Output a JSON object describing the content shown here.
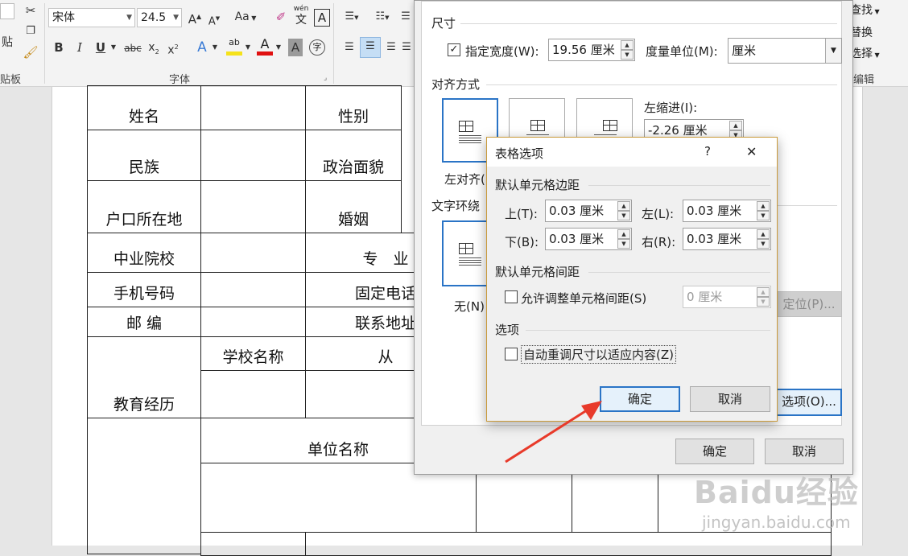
{
  "ribbon": {
    "clipboard": {
      "paste": "贴",
      "group": "贴板"
    },
    "font": {
      "font_name": "宋体",
      "font_size": "24.5",
      "group": "字体",
      "abc": "abc",
      "aa": "Aa",
      "wen": "wén",
      "wen_char": "文",
      "wen_box": "A",
      "char_a": "A",
      "circled": "字"
    },
    "editing": {
      "find": "查找",
      "replace": "替换",
      "select": "选择",
      "group": "编辑"
    },
    "colors": {
      "highlight": "#f5e21a",
      "font_color": "#e01010",
      "accent": "#2a74c6"
    }
  },
  "document": {
    "rows": [
      {
        "c1": "姓名",
        "c3": "性别"
      },
      {
        "c1": "民族",
        "c3": "政治面貌"
      },
      {
        "c1": "户口所在地",
        "c3": "婚姻"
      },
      {
        "c1": "中业院校",
        "c3": "专　业"
      },
      {
        "c1": "手机号码",
        "c3": "固定电话"
      },
      {
        "c1": "邮  编",
        "c3": "联系地址"
      }
    ],
    "edu": {
      "label": "教育经历",
      "school": "学校名称",
      "from": "从"
    },
    "work": {
      "unit": "单位名称"
    }
  },
  "table_properties": {
    "size_title": "尺寸",
    "width_check_label": "指定宽度(W):",
    "width_value": "19.56 厘米",
    "unit_label": "度量单位(M):",
    "unit_value": "厘米",
    "align_title": "对齐方式",
    "left_indent_label": "左缩进(I):",
    "left_indent_value": "-2.26 厘米",
    "align_left_label": "左对齐(L)",
    "wrap_title": "文字环绕",
    "wrap_none_label": "无(N)",
    "position_button": "定位(P)...",
    "options_button": "选项(O)...",
    "ok": "确定",
    "cancel": "取消"
  },
  "table_options": {
    "title": "表格选项",
    "help": "?",
    "close": "✕",
    "margins_title": "默认单元格边距",
    "top_label": "上(T):",
    "top_value": "0.03 厘米",
    "left_label": "左(L):",
    "left_value": "0.03 厘米",
    "bottom_label": "下(B):",
    "bottom_value": "0.03 厘米",
    "right_label": "右(R):",
    "right_value": "0.03 厘米",
    "spacing_title": "默认单元格间距",
    "allow_spacing_label": "允许调整单元格间距(S)",
    "spacing_value": "0 厘米",
    "options_title": "选项",
    "autofit_label": "自动重调尺寸以适应内容(Z)",
    "ok": "确定",
    "cancel": "取消"
  },
  "watermark": {
    "brand": "Baidu经验",
    "url": "jingyan.baidu.com"
  }
}
